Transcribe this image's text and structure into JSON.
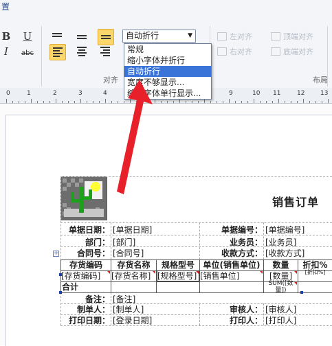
{
  "ribbon": {
    "menu_link": "置",
    "font_buttons": {
      "bold": "B",
      "underline": "U",
      "italic": "I",
      "strike": "abc"
    },
    "combo": {
      "selected": "自动折行",
      "arrow": "▼"
    },
    "disabled": {
      "left_align": "左对齐",
      "top_align": "顶端对齐",
      "right_align": "右对齐",
      "bottom_align": "底端对齐"
    },
    "groups": {
      "align": "对齐",
      "layout": "布局"
    }
  },
  "dropdown": {
    "options": [
      "常规",
      "缩小字体并折行",
      "自动折行",
      "宽度不够显示...",
      "缩小字体单行显示..."
    ],
    "selected_index": 2
  },
  "ruler": {
    "numbers": [
      "0",
      "1",
      "2",
      "3",
      "4",
      "5",
      "6",
      "7",
      "8",
      "9",
      "10",
      "11",
      "12",
      "13"
    ]
  },
  "report": {
    "title": "销售订单",
    "header_fields": {
      "doc_date_label": "单据日期：",
      "doc_date_value": "[单据日期]",
      "doc_no_label": "单据编号：",
      "doc_no_value": "[单据编号]",
      "dept_label": "部门：",
      "dept_value": "[部门]",
      "salesman_label": "业务员：",
      "salesman_value": "[业务员]",
      "contract_label": "合同号：",
      "contract_value": "[合同号]",
      "payment_label": "收款方式：",
      "payment_value": "[收款方式]"
    },
    "table": {
      "headers": [
        "存货编码",
        "存货名称",
        "规格型号",
        "单位(销售单位)",
        "数量",
        "折扣%"
      ],
      "row": [
        "[存货编码]",
        "[存货名称]",
        "[规格型号]",
        "[销售单位]",
        "[数量]",
        "[折扣%]"
      ],
      "total_label": "合计",
      "total_qty": "SUM([数量])"
    },
    "footer_fields": {
      "remark_label": "备注：",
      "remark_value": "[备注]",
      "maker_label": "制单人：",
      "maker_value": "[制单人]",
      "auditor_label": "审核人：",
      "auditor_value": "[审核人]",
      "print_date_label": "打印日期：",
      "print_date_value": "[登录日期]",
      "printer_label": "打印人：",
      "printer_value": "[打印人]"
    }
  },
  "colors": {
    "highlight": "#fbd66a",
    "selection": "#3b74d9",
    "arrow": "#e8202a",
    "dropdown_border": "#6e7e98"
  }
}
